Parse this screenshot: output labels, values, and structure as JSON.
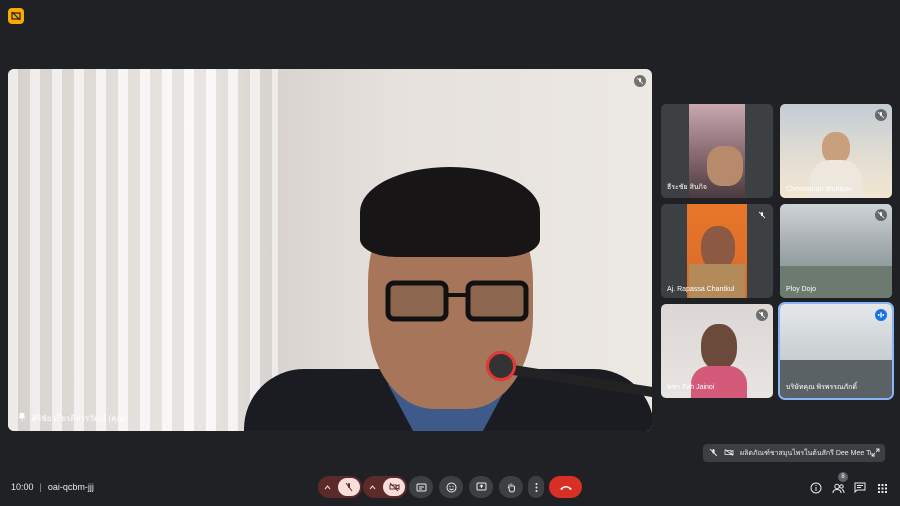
{
  "app": {
    "icon": "present-off-icon",
    "accent": "#f9ab00"
  },
  "main_speaker": {
    "name": "ศิริชัย เกียรติสารวัฒน์ (คุณ)",
    "mic": "mic-off-icon",
    "pin": "pin-icon"
  },
  "participants": [
    {
      "name": "ธีระชัย สินกิจ"
    },
    {
      "name": "Cheewanan Wuttipan"
    },
    {
      "name": "Aj. Rapassa Chantkul"
    },
    {
      "name": "Ploy Dojo"
    },
    {
      "name": "พชร Fah Jainoi"
    },
    {
      "name": "บริษัทคุณ พิรพรรณภักดิ์",
      "speaking": true
    }
  ],
  "pip": {
    "label": "ผลิตภัณฑ์ชาสมุนไพรในต้นสักรี Dee Mee Tea"
  },
  "bottom": {
    "time": "10:00",
    "separator": "|",
    "meeting_code": "oai-qcbm-jjj",
    "participant_count": "8"
  },
  "colors": {
    "background": "#202124",
    "hangup": "#d93025",
    "active_border": "#8ab4f8"
  }
}
